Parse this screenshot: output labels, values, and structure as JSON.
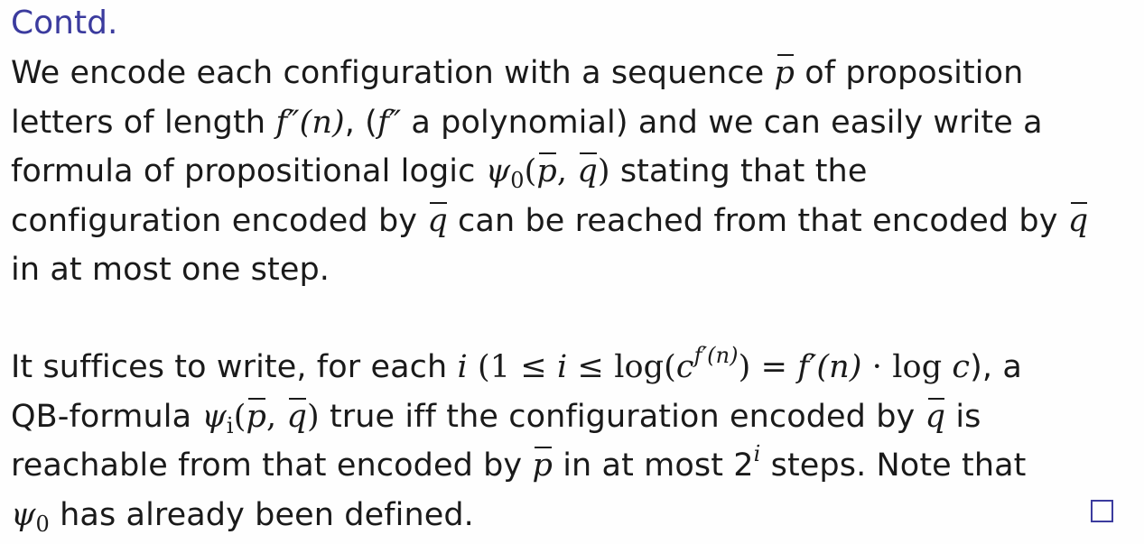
{
  "title": "Contd.",
  "para1": {
    "l1_a": "We encode each configuration with a sequence ",
    "p": "p",
    "l1_b": " of proposition",
    "l2_a": "letters of length ",
    "fpp": "f″(n)",
    "l2_b": ", (",
    "fpp2": "f″",
    "l2_c": " a polynomial) and we can easily write a",
    "l3_a": "formula of propositional logic ",
    "psi": "ψ",
    "zero": "0",
    "open": "(",
    "comma": ", ",
    "q": "q",
    "close": ")",
    "l3_b": " stating that the",
    "l4_a": "configuration encoded by ",
    "l4_b": " can be reached from that encoded by ",
    "l5": "in at most one step."
  },
  "para2": {
    "l1_a": "It suffices to write, for each ",
    "i": "i",
    "l1_b": " (1 ≤ ",
    "l1_c": " ≤ log(",
    "c": "c",
    "exp": "f′(n)",
    "l1_d": ") = ",
    "fp": "f′(n)",
    "l1_e": " · log ",
    "l1_f": "), a",
    "l2_a": "QB-formula ",
    "l2_b": " true iff the configuration encoded by ",
    "l2_c": " is",
    "l3_a": "reachable from that encoded by ",
    "l3_b": " in at most 2",
    "l3_c": " steps. Note that",
    "l4_b": " has already been defined."
  },
  "qed_icon": "square-icon"
}
